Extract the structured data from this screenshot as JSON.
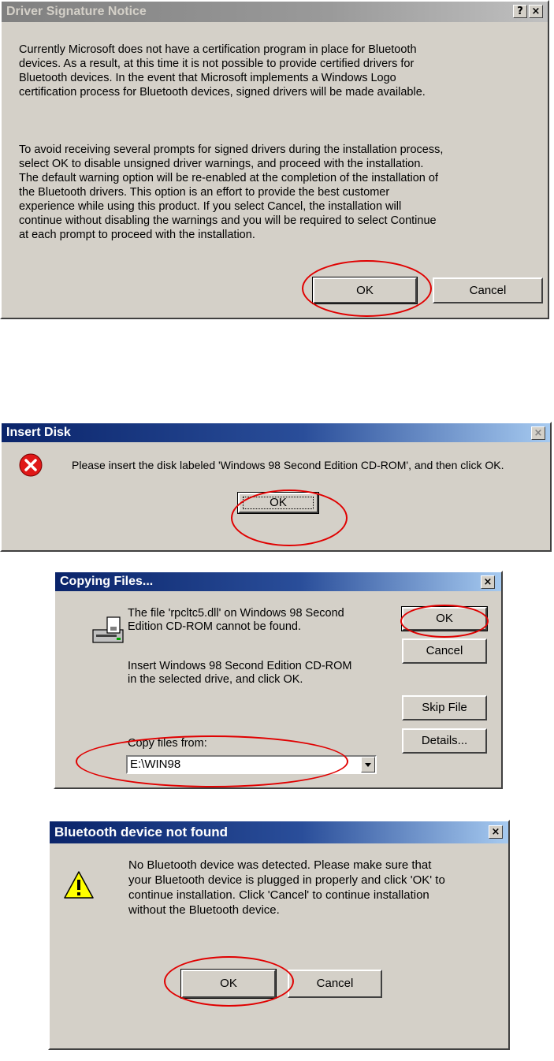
{
  "driver_signature": {
    "title": "Driver Signature Notice",
    "help_btn": "?",
    "close_btn": "×",
    "para1_lines": [
      "Currently Microsoft does not have a certification program in place for Bluetooth",
      "devices. As a result, at this time it is not possible to provide certified drivers for",
      "Bluetooth devices.  In the event that Microsoft implements a Windows Logo",
      "certification process for Bluetooth devices, signed drivers will be made available."
    ],
    "para2_lines": [
      "To avoid receiving several prompts for signed drivers during the installation process,",
      "select OK to disable unsigned driver warnings, and proceed with the installation.",
      "The default warning option will be re-enabled at the completion of the installation of",
      "the Bluetooth drivers. This option is an effort to provide the best customer",
      "experience while using this product. If you select Cancel, the installation will",
      "continue without disabling the warnings and you will be required to select Continue",
      "at each prompt to proceed with the installation."
    ],
    "ok_label": "OK",
    "cancel_label": "Cancel"
  },
  "insert_disk": {
    "title": "Insert Disk",
    "close_btn": "×",
    "message": "Please insert the disk labeled 'Windows 98 Second Edition CD-ROM', and then click OK.",
    "ok_label": "OK"
  },
  "copying_files": {
    "title": "Copying Files...",
    "close_btn": "×",
    "message1_lines": [
      "The file 'rpcltc5.dll' on Windows 98 Second",
      "Edition CD-ROM cannot be found."
    ],
    "message2_lines": [
      "Insert Windows 98 Second Edition CD-ROM",
      "in the selected drive, and click OK."
    ],
    "ok_label": "OK",
    "cancel_label": "Cancel",
    "skip_label": "Skip File",
    "details_label": "Details...",
    "copy_from_label": "Copy files from:",
    "copy_from_value": "E:\\WIN98"
  },
  "bluetooth_not_found": {
    "title": "Bluetooth device not found",
    "close_btn": "×",
    "message_lines": [
      "No Bluetooth device was detected. Please make sure that",
      "your Bluetooth device is plugged in properly and click 'OK' to",
      "continue installation. Click 'Cancel' to continue installation",
      "without the Bluetooth device."
    ],
    "ok_label": "OK",
    "cancel_label": "Cancel"
  },
  "colors": {
    "highlight_circle": "#e00000",
    "dialog_face": "#d4d0c8",
    "title_blue": "#0a246a"
  }
}
